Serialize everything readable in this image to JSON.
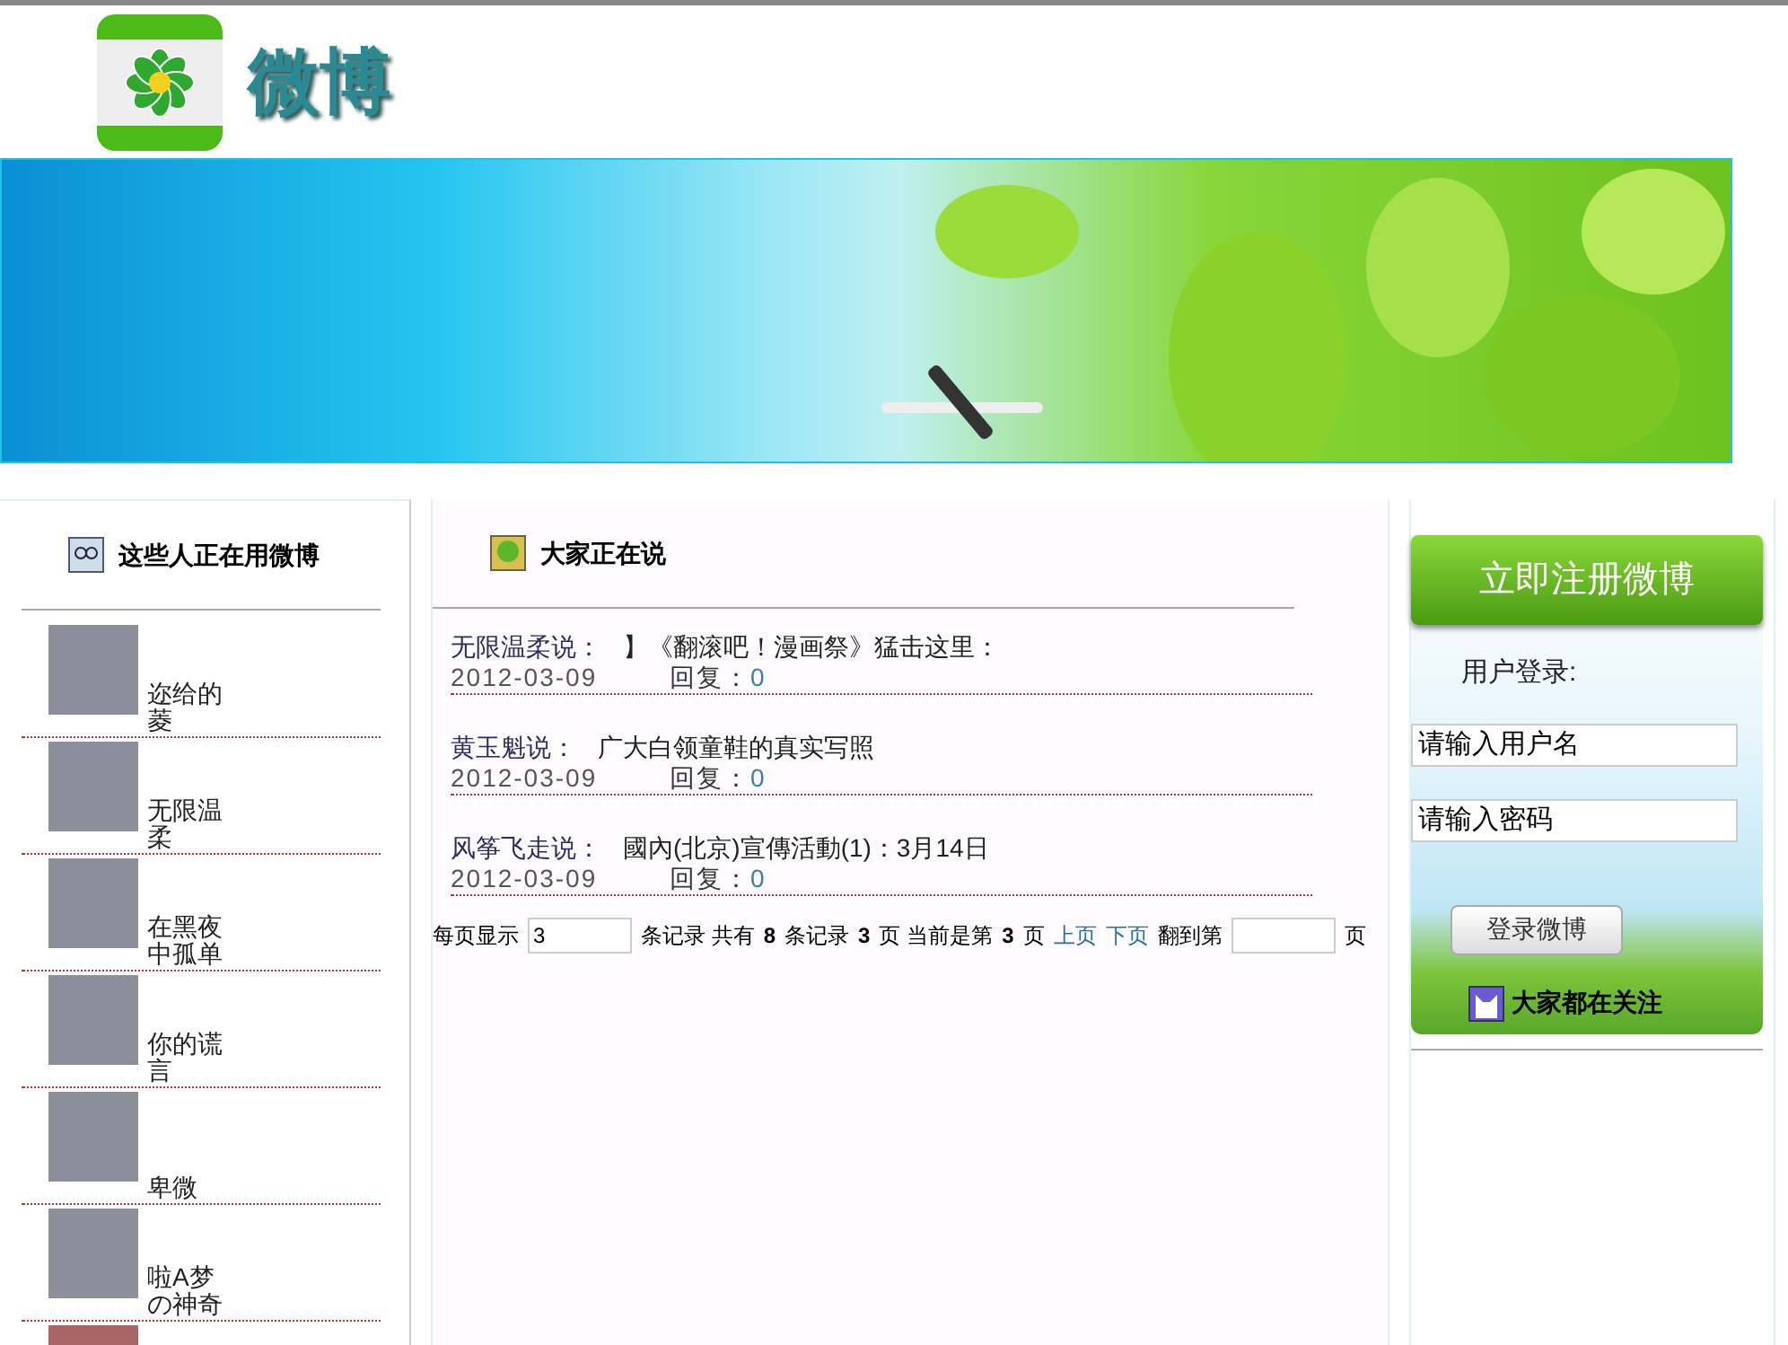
{
  "header": {
    "logo_text": "微博"
  },
  "left_panel": {
    "title": "这些人正在用微博",
    "users": [
      {
        "name": "迩给的菱"
      },
      {
        "name": "无限温柔"
      },
      {
        "name": "在黑夜中孤单"
      },
      {
        "name": "你的谎言"
      },
      {
        "name": "卑微"
      },
      {
        "name": "啦A梦の神奇"
      }
    ]
  },
  "main_panel": {
    "title": "大家正在说",
    "posts": [
      {
        "author": "无限温柔说：",
        "content": "】《翻滚吧！漫画祭》猛击这里：",
        "date": "2012-03-09",
        "reply_label": "回复：",
        "reply_count": "0"
      },
      {
        "author": "黄玉魁说：",
        "content": "广大白领童鞋的真实写照",
        "date": "2012-03-09",
        "reply_label": "回复：",
        "reply_count": "0"
      },
      {
        "author": "风筝飞走说：",
        "content": "國內(北京)宣傳活動(1)：3月14日",
        "date": "2012-03-09",
        "reply_label": "回复：",
        "reply_count": "0"
      }
    ],
    "pagination": [
      {
        "kind": "text",
        "text": "每页显示"
      },
      {
        "kind": "input",
        "text": "3"
      },
      {
        "kind": "text",
        "text": "条记录 共有"
      },
      {
        "kind": "bold",
        "text": "8"
      },
      {
        "kind": "text",
        "text": "条记录"
      },
      {
        "kind": "bold",
        "text": "3"
      },
      {
        "kind": "text",
        "text": "页 当前是第"
      },
      {
        "kind": "bold",
        "text": "3"
      },
      {
        "kind": "text",
        "text": "页"
      },
      {
        "kind": "link",
        "text": "上页"
      },
      {
        "kind": "link",
        "text": "下页"
      },
      {
        "kind": "text",
        "text": "翻到第"
      },
      {
        "kind": "input"
      },
      {
        "kind": "text",
        "text": "页"
      }
    ]
  },
  "right_panel": {
    "register_button": "立即注册微博",
    "login_title": "用户登录:",
    "username": "请输入用户名",
    "password": "请输入密码",
    "login_button": "登录微博",
    "following_title": "大家都在关注"
  }
}
